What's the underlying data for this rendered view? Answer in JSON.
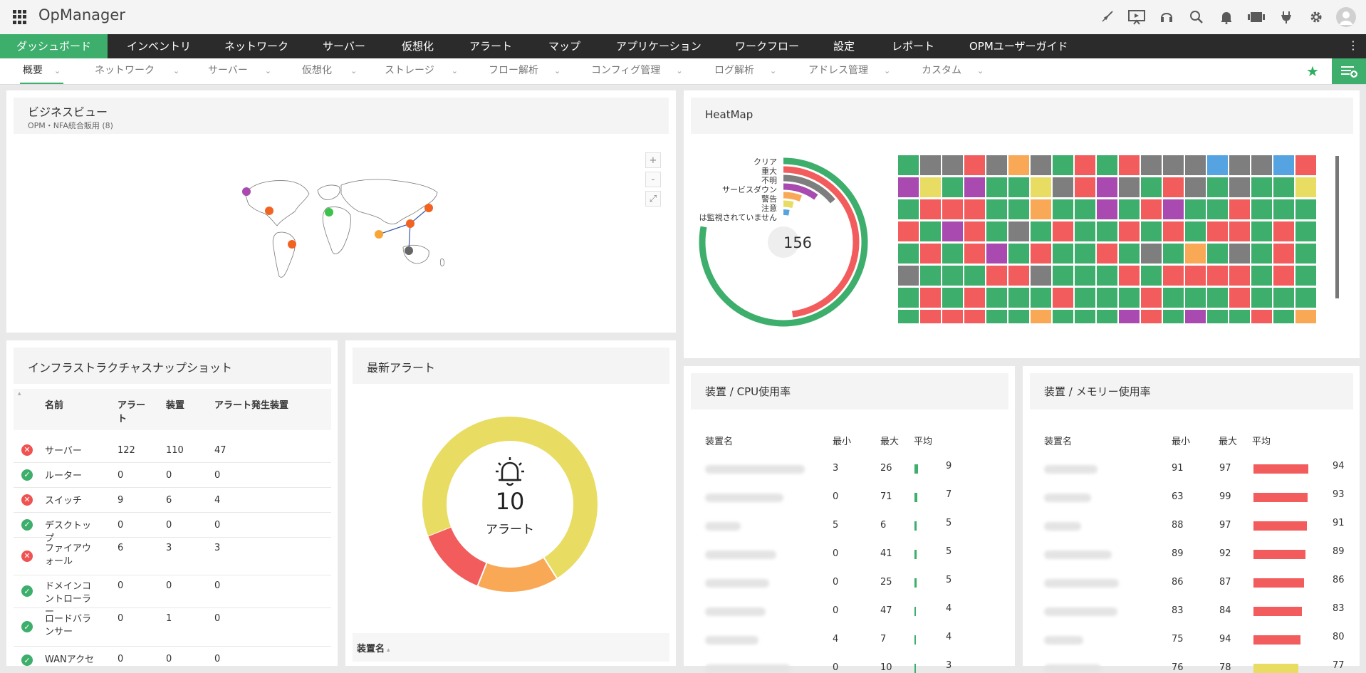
{
  "app": {
    "title": "OpManager"
  },
  "topbar_icons": [
    "rocket-icon",
    "presentation-icon",
    "headset-icon",
    "search-icon",
    "bell-icon",
    "device-icon",
    "plug-icon",
    "gear-icon",
    "user-avatar-icon"
  ],
  "main_nav": [
    "ダッシュボード",
    "インベントリ",
    "ネットワーク",
    "サーバー",
    "仮想化",
    "アラート",
    "マップ",
    "アプリケーション",
    "ワークフロー",
    "設定",
    "レポート",
    "OPMユーザーガイド"
  ],
  "sub_nav": [
    "概要",
    "ネットワーク",
    "サーバー",
    "仮想化",
    "ストレージ",
    "フロー解析",
    "コンフィグ管理",
    "ログ解析",
    "アドレス管理",
    "カスタム"
  ],
  "business_view": {
    "title": "ビジネスビュー",
    "subtitle": "OPM・NFA統合販用 (8)",
    "controls": [
      "+",
      "-",
      "⤢"
    ]
  },
  "heatmap": {
    "title": "HeatMap",
    "total": "156",
    "legend": [
      "クリア",
      "重大",
      "不明",
      "サービスダウン",
      "警告",
      "注意",
      "は監視されていません"
    ]
  },
  "infra": {
    "title": "インフラストラクチャスナップショット",
    "columns": [
      "名前",
      "アラート",
      "装置",
      "アラート発生装置"
    ],
    "rows": [
      {
        "status": "error",
        "name": "サーバー",
        "alerts": "122",
        "devices": "110",
        "alerting": "47"
      },
      {
        "status": "ok",
        "name": "ルーター",
        "alerts": "0",
        "devices": "0",
        "alerting": "0"
      },
      {
        "status": "error",
        "name": "スイッチ",
        "alerts": "9",
        "devices": "6",
        "alerting": "4"
      },
      {
        "status": "ok",
        "name": "デスクトップ",
        "alerts": "0",
        "devices": "0",
        "alerting": "0"
      },
      {
        "status": "error",
        "name": "ファイアウォール",
        "alerts": "6",
        "devices": "3",
        "alerting": "3"
      },
      {
        "status": "ok",
        "name": "ドメインコントローラー",
        "alerts": "0",
        "devices": "0",
        "alerting": "0"
      },
      {
        "status": "ok",
        "name": "ロードバランサー",
        "alerts": "0",
        "devices": "1",
        "alerting": "0"
      },
      {
        "status": "ok",
        "name": "WANアクセ",
        "alerts": "0",
        "devices": "0",
        "alerting": "0"
      }
    ]
  },
  "alerts": {
    "title": "最新アラート",
    "count": "10",
    "label": "アラート",
    "table_header": "装置名"
  },
  "cpu": {
    "title": "装置 / CPU使用率",
    "columns": [
      "装置名",
      "最小",
      "最大",
      "平均"
    ],
    "rows": [
      {
        "min": "3",
        "max": "26",
        "avg": "9"
      },
      {
        "min": "0",
        "max": "71",
        "avg": "7"
      },
      {
        "min": "5",
        "max": "6",
        "avg": "5"
      },
      {
        "min": "0",
        "max": "41",
        "avg": "5"
      },
      {
        "min": "0",
        "max": "25",
        "avg": "5"
      },
      {
        "min": "0",
        "max": "47",
        "avg": "4"
      },
      {
        "min": "4",
        "max": "7",
        "avg": "4"
      },
      {
        "min": "0",
        "max": "10",
        "avg": "3"
      }
    ]
  },
  "memory": {
    "title": "装置 / メモリー使用率",
    "columns": [
      "装置名",
      "最小",
      "最大",
      "平均"
    ],
    "rows": [
      {
        "min": "91",
        "max": "97",
        "avg": "94"
      },
      {
        "min": "63",
        "max": "99",
        "avg": "93"
      },
      {
        "min": "88",
        "max": "97",
        "avg": "91"
      },
      {
        "min": "89",
        "max": "92",
        "avg": "89"
      },
      {
        "min": "86",
        "max": "87",
        "avg": "86"
      },
      {
        "min": "83",
        "max": "84",
        "avg": "83"
      },
      {
        "min": "75",
        "max": "94",
        "avg": "80"
      },
      {
        "min": "76",
        "max": "78",
        "avg": "77"
      }
    ]
  },
  "colors": {
    "green": "#3dae6c",
    "red": "#f25c5c",
    "gray": "#7e7e7e",
    "yellow": "#e8dc63",
    "orange": "#f9a856",
    "purple": "#a84ab0",
    "blue": "#55a3e0"
  }
}
